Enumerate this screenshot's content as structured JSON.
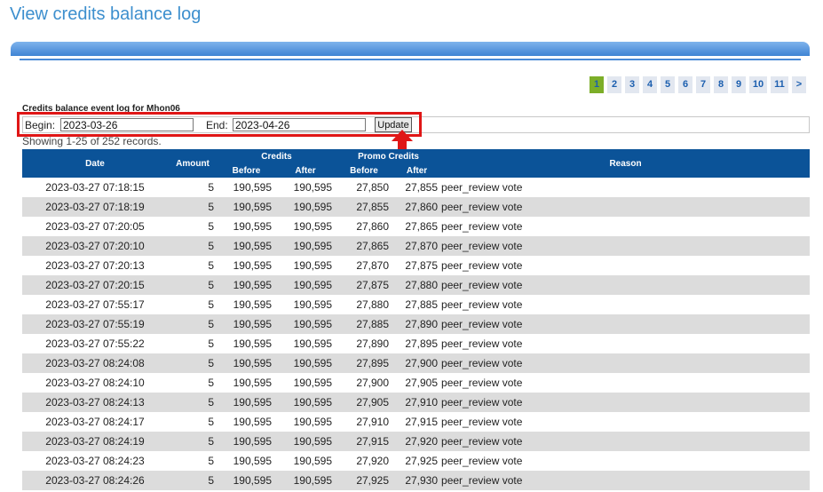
{
  "page": {
    "title": "View credits balance log"
  },
  "pagination": {
    "pages": [
      "1",
      "2",
      "3",
      "4",
      "5",
      "6",
      "7",
      "8",
      "9",
      "10",
      "11",
      ">"
    ],
    "active": "1"
  },
  "log": {
    "caption": "Credits balance event log for Mhon06"
  },
  "filter": {
    "begin_label": "Begin:",
    "begin_value": "2023-03-26",
    "end_label": "End:",
    "end_value": "2023-04-26",
    "update_label": "Update"
  },
  "annotation": {
    "color": "#e01616"
  },
  "summary": {
    "showing": "Showing 1-25 of 252 records."
  },
  "table": {
    "headers": {
      "date": "Date",
      "amount": "Amount",
      "credits": "Credits",
      "promo_credits": "Promo Credits",
      "before": "Before",
      "after": "After",
      "reason": "Reason"
    },
    "rows": [
      {
        "date": "2023-03-27 07:18:15",
        "amount": "5",
        "credits_before": "190,595",
        "credits_after": "190,595",
        "promo_before": "27,850",
        "promo_after": "27,855",
        "reason": "peer_review vote"
      },
      {
        "date": "2023-03-27 07:18:19",
        "amount": "5",
        "credits_before": "190,595",
        "credits_after": "190,595",
        "promo_before": "27,855",
        "promo_after": "27,860",
        "reason": "peer_review vote"
      },
      {
        "date": "2023-03-27 07:20:05",
        "amount": "5",
        "credits_before": "190,595",
        "credits_after": "190,595",
        "promo_before": "27,860",
        "promo_after": "27,865",
        "reason": "peer_review vote"
      },
      {
        "date": "2023-03-27 07:20:10",
        "amount": "5",
        "credits_before": "190,595",
        "credits_after": "190,595",
        "promo_before": "27,865",
        "promo_after": "27,870",
        "reason": "peer_review vote"
      },
      {
        "date": "2023-03-27 07:20:13",
        "amount": "5",
        "credits_before": "190,595",
        "credits_after": "190,595",
        "promo_before": "27,870",
        "promo_after": "27,875",
        "reason": "peer_review vote"
      },
      {
        "date": "2023-03-27 07:20:15",
        "amount": "5",
        "credits_before": "190,595",
        "credits_after": "190,595",
        "promo_before": "27,875",
        "promo_after": "27,880",
        "reason": "peer_review vote"
      },
      {
        "date": "2023-03-27 07:55:17",
        "amount": "5",
        "credits_before": "190,595",
        "credits_after": "190,595",
        "promo_before": "27,880",
        "promo_after": "27,885",
        "reason": "peer_review vote"
      },
      {
        "date": "2023-03-27 07:55:19",
        "amount": "5",
        "credits_before": "190,595",
        "credits_after": "190,595",
        "promo_before": "27,885",
        "promo_after": "27,890",
        "reason": "peer_review vote"
      },
      {
        "date": "2023-03-27 07:55:22",
        "amount": "5",
        "credits_before": "190,595",
        "credits_after": "190,595",
        "promo_before": "27,890",
        "promo_after": "27,895",
        "reason": "peer_review vote"
      },
      {
        "date": "2023-03-27 08:24:08",
        "amount": "5",
        "credits_before": "190,595",
        "credits_after": "190,595",
        "promo_before": "27,895",
        "promo_after": "27,900",
        "reason": "peer_review vote"
      },
      {
        "date": "2023-03-27 08:24:10",
        "amount": "5",
        "credits_before": "190,595",
        "credits_after": "190,595",
        "promo_before": "27,900",
        "promo_after": "27,905",
        "reason": "peer_review vote"
      },
      {
        "date": "2023-03-27 08:24:13",
        "amount": "5",
        "credits_before": "190,595",
        "credits_after": "190,595",
        "promo_before": "27,905",
        "promo_after": "27,910",
        "reason": "peer_review vote"
      },
      {
        "date": "2023-03-27 08:24:17",
        "amount": "5",
        "credits_before": "190,595",
        "credits_after": "190,595",
        "promo_before": "27,910",
        "promo_after": "27,915",
        "reason": "peer_review vote"
      },
      {
        "date": "2023-03-27 08:24:19",
        "amount": "5",
        "credits_before": "190,595",
        "credits_after": "190,595",
        "promo_before": "27,915",
        "promo_after": "27,920",
        "reason": "peer_review vote"
      },
      {
        "date": "2023-03-27 08:24:23",
        "amount": "5",
        "credits_before": "190,595",
        "credits_after": "190,595",
        "promo_before": "27,920",
        "promo_after": "27,925",
        "reason": "peer_review vote"
      },
      {
        "date": "2023-03-27 08:24:26",
        "amount": "5",
        "credits_before": "190,595",
        "credits_after": "190,595",
        "promo_before": "27,925",
        "promo_after": "27,930",
        "reason": "peer_review vote"
      }
    ]
  }
}
